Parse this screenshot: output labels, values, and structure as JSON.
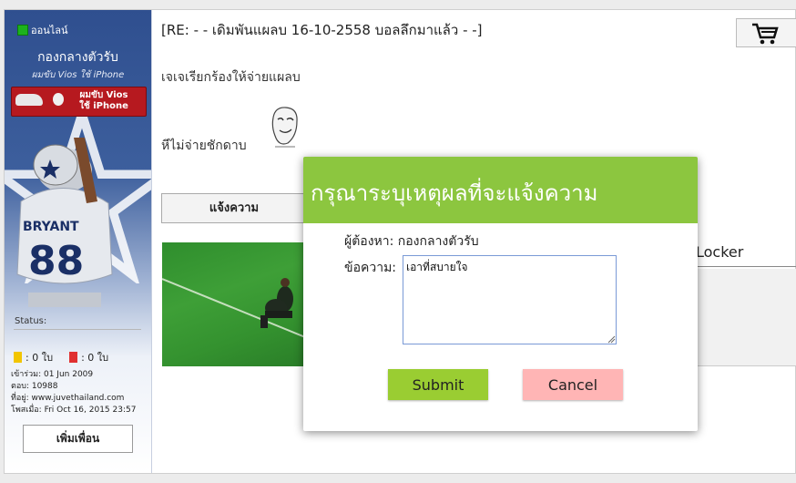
{
  "profile": {
    "online_label": "ออนไลน์",
    "username": "กองกลางตัวรับ",
    "user_title": "ผมขับ Vios ใช้ iPhone",
    "banner_line1": "ผมขับ Vios",
    "banner_line2": "ใช้ iPhone",
    "status_label": "Status:",
    "yellow_cards": ": 0 ใบ",
    "red_cards": ": 0 ใบ",
    "joined": "เข้าร่วม: 01 Jun 2009",
    "replies": "ตอบ: 10988",
    "location": "ที่อยู่: www.juvethailand.com",
    "posted": "โพสเมื่อ: Fri Oct 16, 2015 23:57",
    "add_friend_label": "เพิ่มเพื่อน",
    "jersey_name": "BRYANT",
    "jersey_number": "88"
  },
  "post": {
    "title": "[RE: - - เดิมพันแผลบ 16-10-2558 บอลลึกมาแล้ว - -]",
    "line1": "เจเจเรียกร้องให้จ่ายแผลบ",
    "line2": "หีไม่จ่ายชักดาบ",
    "report_button": "แจ้งความ",
    "locker_text": "Locker"
  },
  "modal": {
    "title": "กรุณาระบุเหตุผลที่จะแจ้งความ",
    "to_label": "ผู้ต้องหา: กองกลางตัวรับ",
    "message_label": "ข้อความ:",
    "message_value": "เอาที่สบายใจ",
    "submit_label": "Submit",
    "cancel_label": "Cancel"
  },
  "colors": {
    "modal_header": "#8cc63f",
    "submit": "#9acd32",
    "cancel": "#ffb5b5",
    "online_dot": "#1db21d"
  },
  "icons": [
    "cart-icon",
    "grip-icon",
    "star-icon"
  ]
}
